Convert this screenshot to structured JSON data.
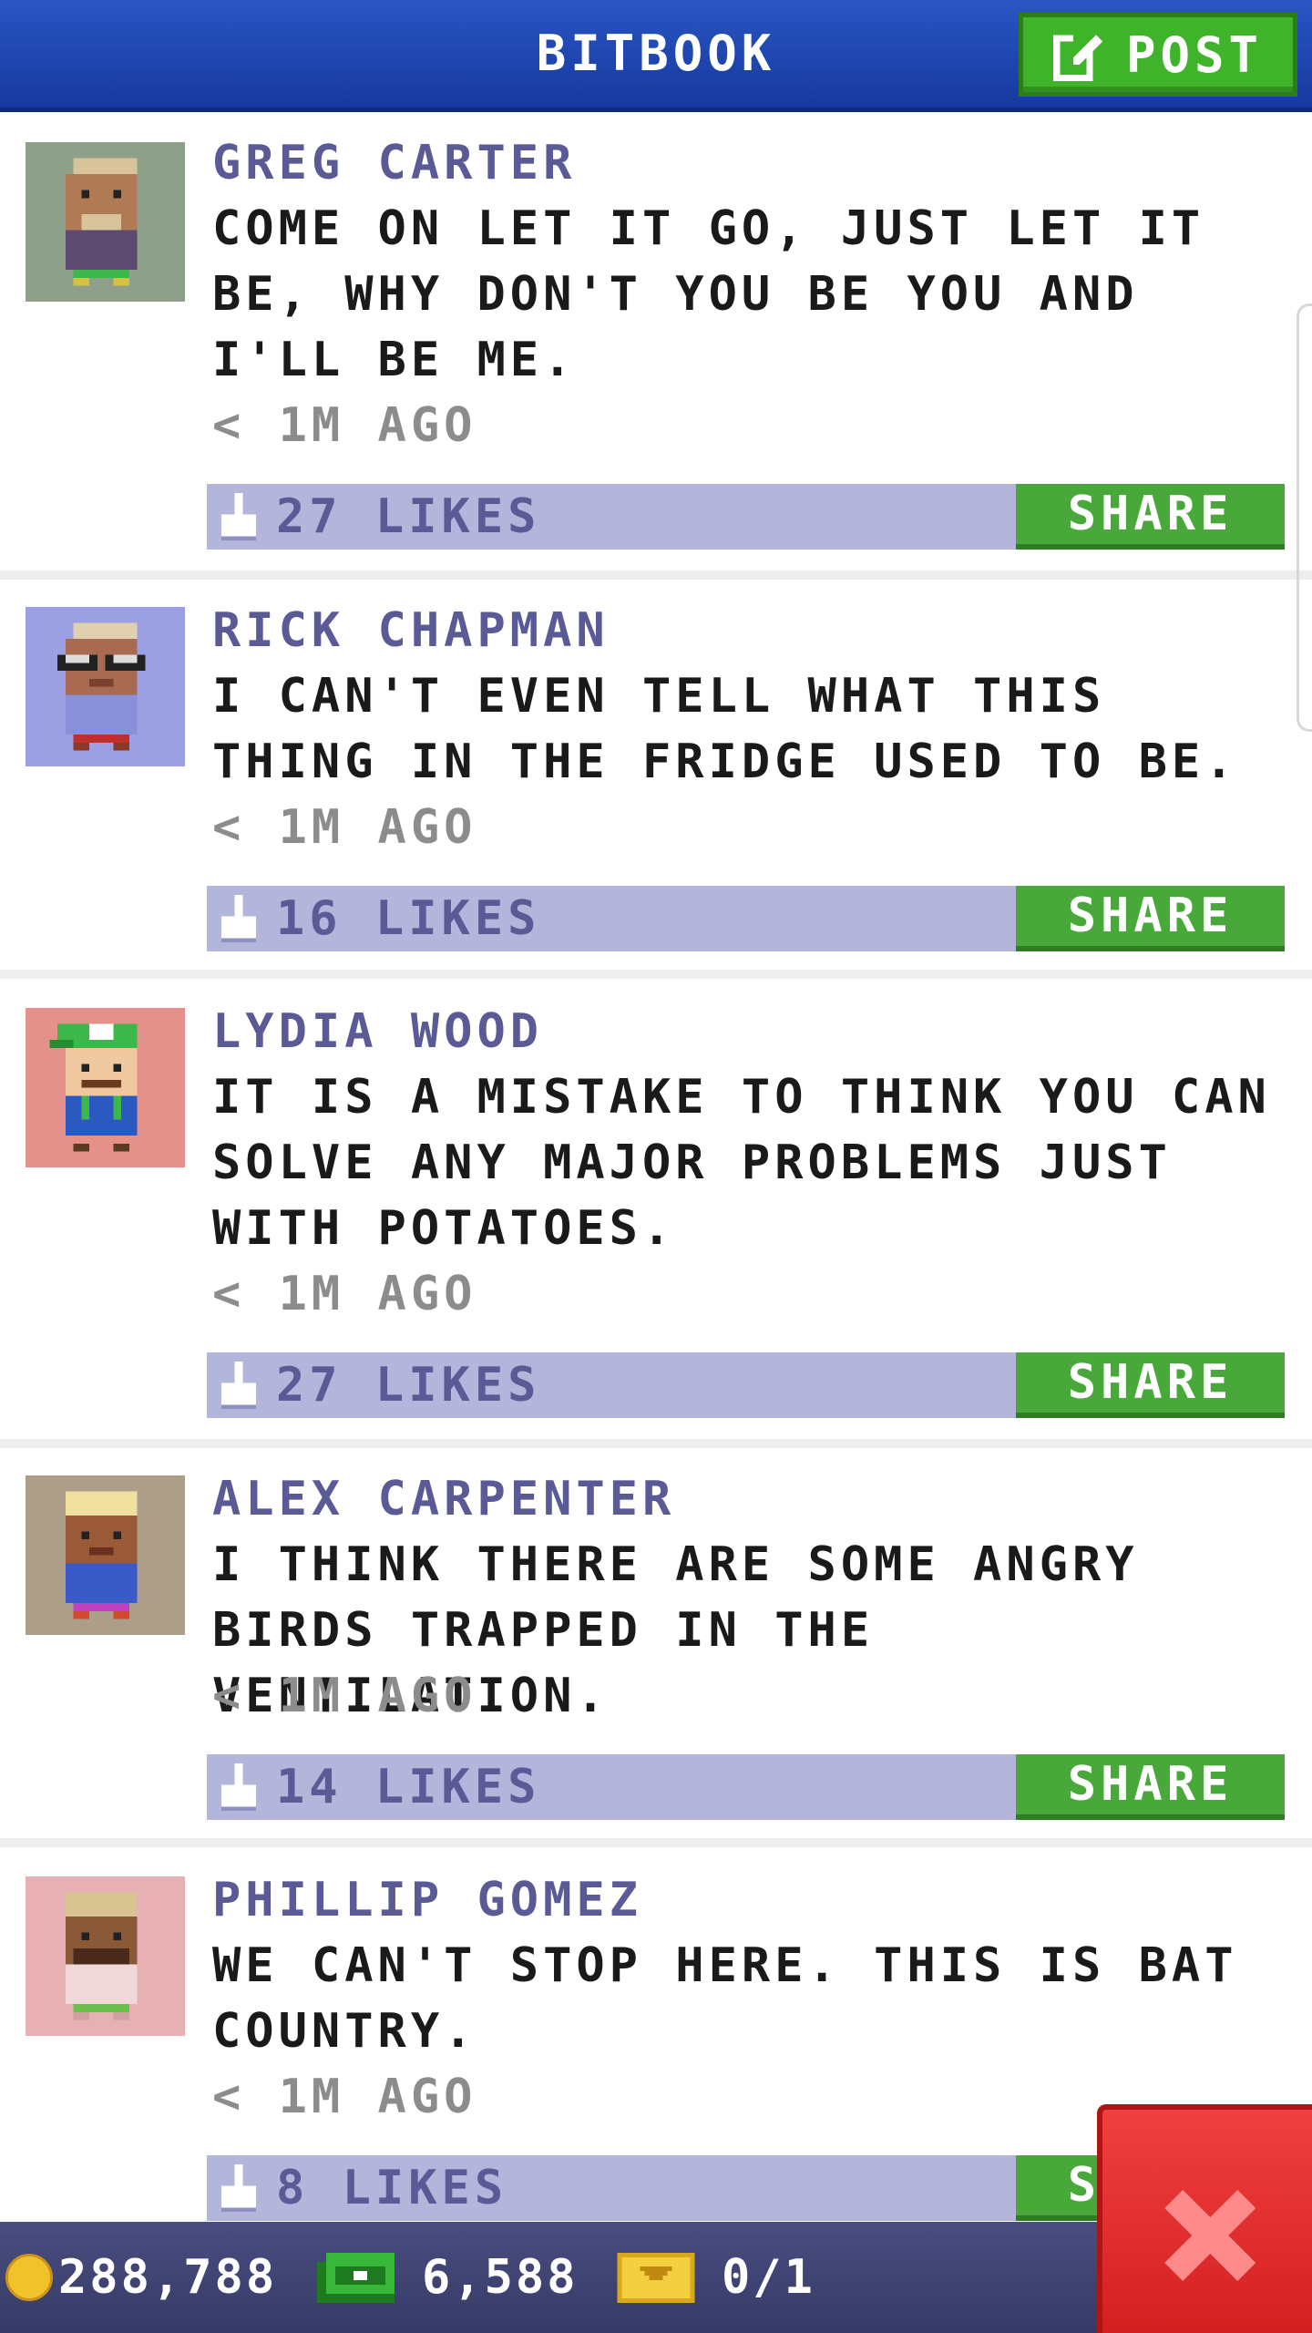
{
  "header": {
    "title": "BITBOOK",
    "post_label": "POST"
  },
  "posts": [
    {
      "author": "GREG CARTER",
      "message": "COME ON LET IT GO, JUST LET IT BE, WHY DON'T YOU BE YOU AND I'LL BE ME.",
      "time": "< 1M AGO",
      "likes": "27 LIKES",
      "share": "SHARE",
      "avatar_bg": "#8fa08a"
    },
    {
      "author": "RICK CHAPMAN",
      "message": "I CAN'T EVEN TELL WHAT THIS THING IN THE FRIDGE USED TO BE.",
      "time": "< 1M AGO",
      "likes": "16 LIKES",
      "share": "SHARE",
      "avatar_bg": "#9ca0e2"
    },
    {
      "author": "LYDIA WOOD",
      "message": "IT IS A MISTAKE TO THINK YOU CAN SOLVE ANY MAJOR PROBLEMS JUST WITH POTATOES.",
      "time": "< 1M AGO",
      "likes": "27 LIKES",
      "share": "SHARE",
      "avatar_bg": "#e3918a"
    },
    {
      "author": "ALEX CARPENTER",
      "message": "I THINK THERE ARE SOME ANGRY BIRDS TRAPPED IN THE VENTILATION.",
      "time": "< 1M AGO",
      "likes": "14 LIKES",
      "share": "SHARE",
      "avatar_bg": "#ac9e88"
    },
    {
      "author": "PHILLIP GOMEZ",
      "message": "WE CAN'T STOP HERE. THIS IS BAT COUNTRY.",
      "time": "< 1M AGO",
      "likes": "8 LIKES",
      "share": "SHARE",
      "avatar_bg": "#e6b0b4"
    }
  ],
  "footer": {
    "coins": "288,788",
    "bux": "6,588",
    "tickets": "0/1"
  },
  "colors": {
    "header_blue": "#1f47b2",
    "likes_bar": "#b3b5da",
    "share_green": "#49a83a",
    "close_red": "#e02c2c"
  },
  "icons": {
    "post": "edit-icon",
    "like": "thumbs-up-icon",
    "close": "close-icon",
    "coin": "coin-icon",
    "bux": "bux-icon",
    "ticket": "ticket-icon"
  }
}
